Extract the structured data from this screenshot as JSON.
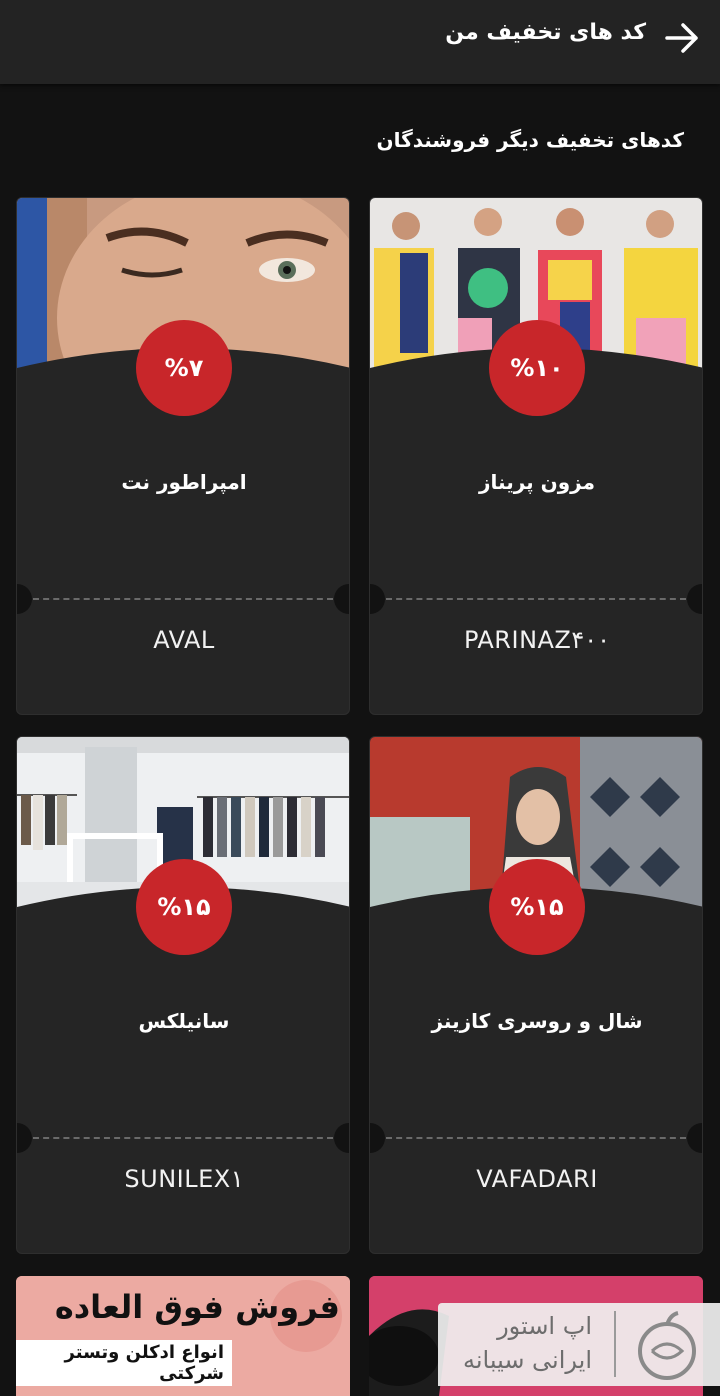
{
  "header": {
    "title": "کد های تخفیف من",
    "back_icon": "arrow-right-icon"
  },
  "section": {
    "title": "کدهای تخفیف دیگر فروشندگان"
  },
  "coupons": [
    {
      "store": "مزون پریناز",
      "discount": "%۱۰",
      "code": "PARINAZ۴۰۰",
      "image": "fashion-models-photo"
    },
    {
      "store": "امپراطور نت",
      "discount": "%۷",
      "code": "AVAL",
      "image": "woman-face-photo"
    },
    {
      "store": "شال و روسری کازینز",
      "discount": "%۱۵",
      "code": "VAFADARI",
      "image": "scarf-model-photo"
    },
    {
      "store": "سانیلکس",
      "discount": "%۱۵",
      "code": "SUNILEX۱",
      "image": "clothing-store-photo"
    }
  ],
  "promo": {
    "headline": "فروش فوق العاده",
    "subline": "انواع ادکلن وتستر شرکتی"
  },
  "watermark": {
    "line1": "اپ استور",
    "line2": "ایرانی سیبانه"
  },
  "colors": {
    "badge": "#c8262a",
    "card": "#252525",
    "background": "#121212"
  }
}
